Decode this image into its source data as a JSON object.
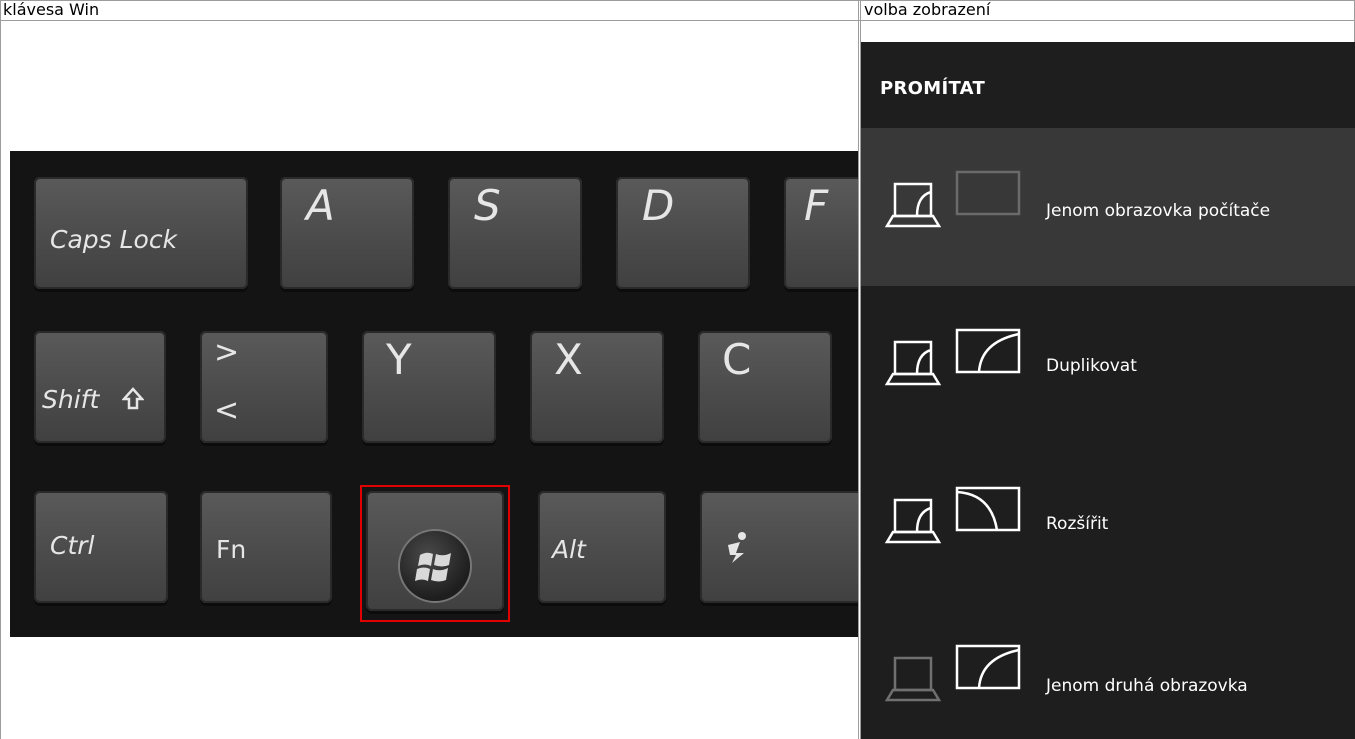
{
  "table": {
    "col1_header": "klávesa Win",
    "col2_header": "volba zobrazení"
  },
  "keyboard": {
    "row1": [
      "Caps Lock",
      "A",
      "S",
      "D",
      "F"
    ],
    "row2": [
      "Shift",
      ">",
      "<",
      "Y",
      "X",
      "C"
    ],
    "row3": [
      "Ctrl",
      "Fn",
      "Alt"
    ],
    "highlight_color": "#e00000"
  },
  "projection": {
    "title": "PROMÍTAT",
    "options": [
      {
        "label": "Jenom obrazovka počítače",
        "icon": "pc-screen-only-icon",
        "selected": true
      },
      {
        "label": "Duplikovat",
        "icon": "duplicate-icon",
        "selected": false
      },
      {
        "label": "Rozšířit",
        "icon": "extend-icon",
        "selected": false
      },
      {
        "label": "Jenom druhá obrazovka",
        "icon": "second-screen-only-icon",
        "selected": false
      }
    ]
  }
}
